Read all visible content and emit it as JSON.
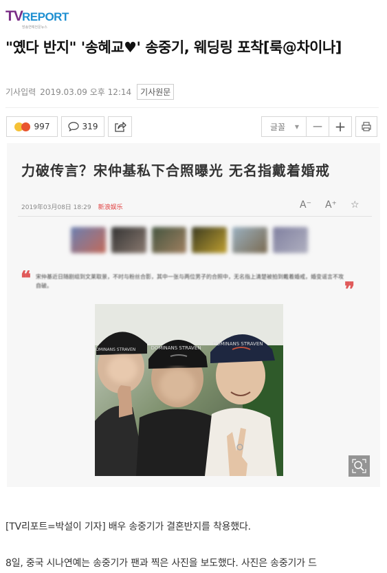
{
  "header": {
    "logo_tv": "TV",
    "logo_report": "REPORT",
    "logo_sub": "방송연예전문뉴스"
  },
  "article": {
    "headline": "\"옜다 반지\" '송혜교♥' 송중기, 웨딩링 포착[룩@차이나]",
    "input_label": "기사입력",
    "date": "2019.03.09 오후 12:14",
    "original_label": "기사원문"
  },
  "toolbar": {
    "reaction_count": "997",
    "comment_count": "319",
    "font_label": "글꼴",
    "minus_label": "—",
    "plus_label": "+"
  },
  "embed": {
    "title": "力破传言？宋仲基私下合照曝光 无名指戴着婚戒",
    "date": "2019年03月08日 18:29",
    "source": "新浪娱乐",
    "tool_labels": [
      "A⁻",
      "A⁺",
      "☆"
    ],
    "quote": "宋仲基近日随剧组到文莱取景，不时与粉丝合影，其中一张与两位男子的合照中，无名指上清楚被拍到戴着婚戒，婚变谣言不攻自破。",
    "cap_text": "DOMINANS STRAVEN"
  },
  "body": {
    "line1": "[TV리포트=박설이 기자] 배우 송중기가 결혼반지를 착용했다.",
    "line2": "8일, 중국 시나연예는 송중기가 팬과 찍은 사진을 보도했다. 사진은 송중기가 드"
  },
  "colors": {
    "logo_purple": "#7a2d86",
    "logo_blue": "#1d8fd1",
    "quote_red": "#e05a5a"
  }
}
